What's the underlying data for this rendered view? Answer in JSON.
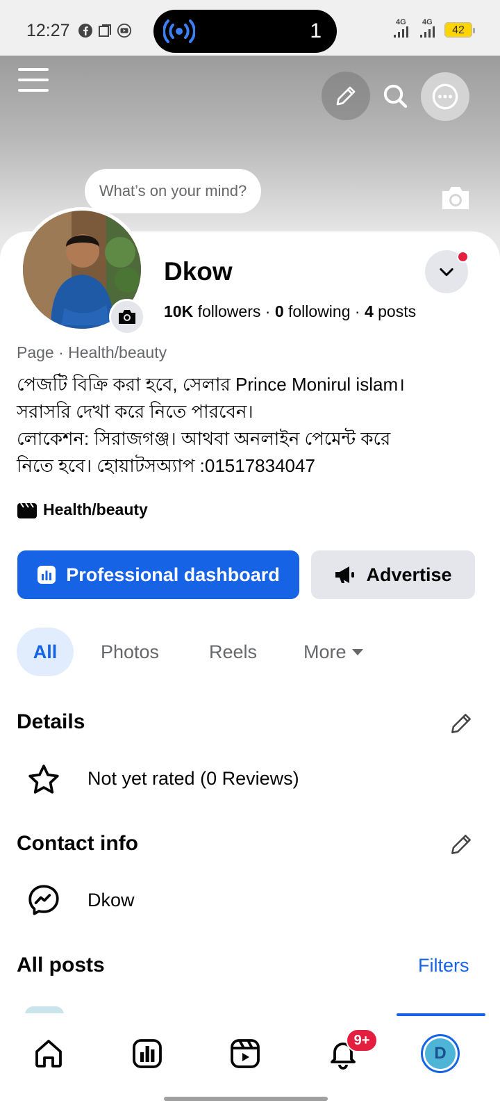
{
  "status_bar": {
    "time": "12:27",
    "notification_count": "1",
    "network_1": "4G",
    "network_2": "4G",
    "battery": "42"
  },
  "cover": {
    "thought_prompt": "What’s on your mind?"
  },
  "profile": {
    "name": "Dkow",
    "followers_count": "10K",
    "followers_label": "followers",
    "following_count": "0",
    "following_label": "following",
    "posts_count": "4",
    "posts_label": "posts",
    "separator": "·",
    "category_line": "Page · Health/beauty",
    "bio": [
      "পেজটি বিক্রি করা হবে, সেলার Prince Monirul islam।",
      "সরাসরি দেখা করে নিতে পারবেন।",
      "লোকেশন: সিরাজগঞ্জ। আথবা অনলাইন পেমেন্ট করে",
      "নিতে হবে। হোয়াটসঅ্যাপ :01517834047"
    ],
    "category_tag": "Health/beauty"
  },
  "actions": {
    "professional_dashboard": "Professional dashboard",
    "advertise": "Advertise"
  },
  "tabs": [
    {
      "label": "All",
      "active": true
    },
    {
      "label": "Photos"
    },
    {
      "label": "Reels"
    },
    {
      "label": "More"
    }
  ],
  "details": {
    "title": "Details",
    "rating_text": "Not yet rated (0 Reviews)"
  },
  "contact": {
    "title": "Contact info",
    "messenger_name": "Dkow"
  },
  "posts": {
    "title": "All posts",
    "filters": "Filters"
  },
  "bottom_nav": {
    "notification_badge": "9+",
    "profile_initial": "D"
  },
  "colors": {
    "accent": "#1763e5",
    "badge": "#e41e3f"
  }
}
